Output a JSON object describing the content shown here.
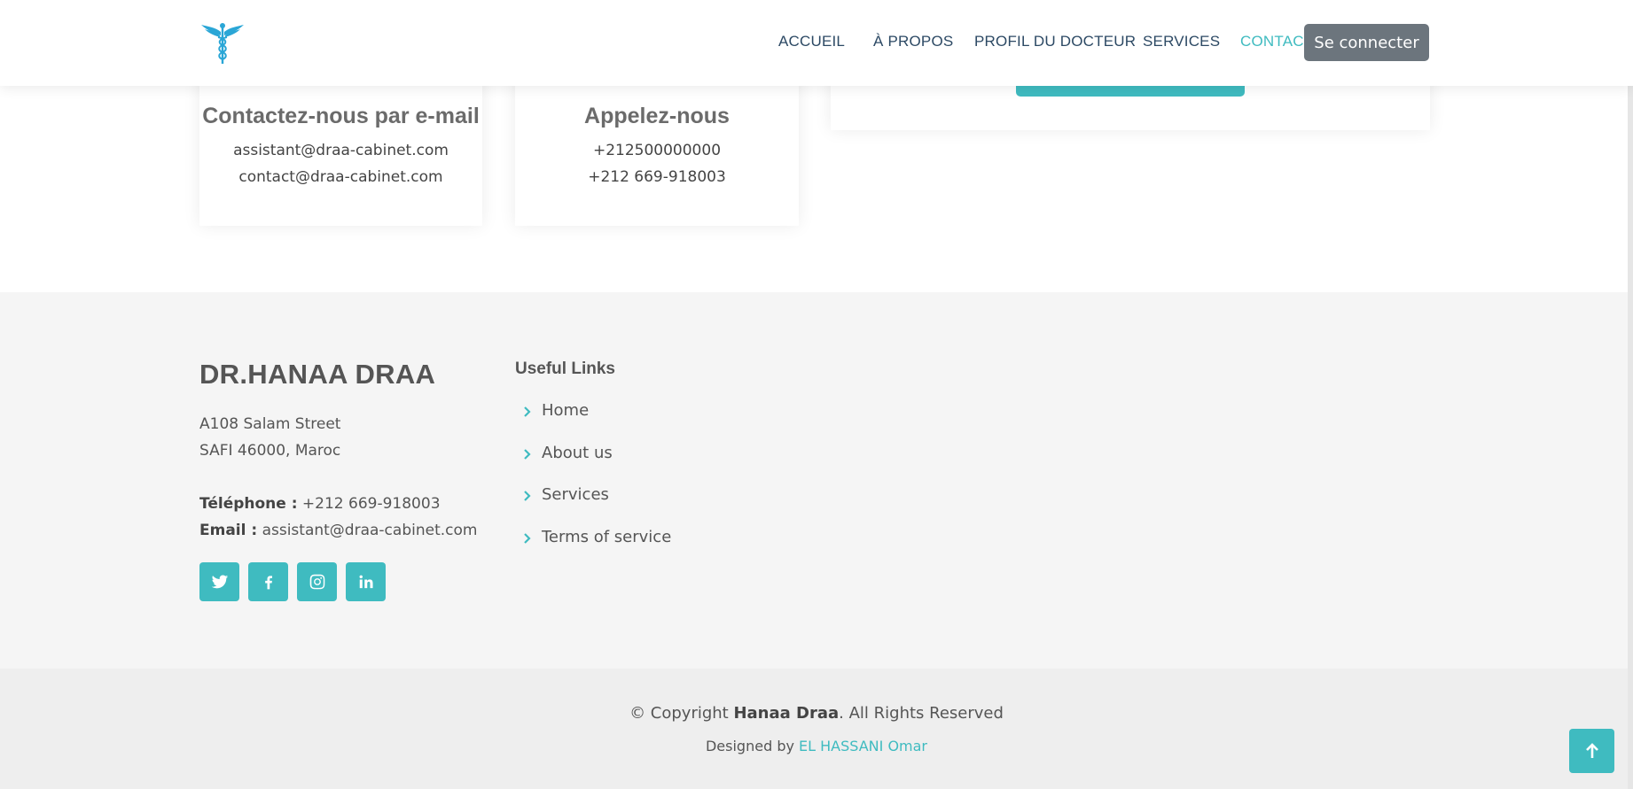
{
  "header": {
    "logo_icon": "caduceus-icon",
    "nav": [
      "ACCUEIL",
      "À PROPOS",
      "PROFIL DU DOCTEUR",
      "SERVICES",
      "CONTACT"
    ],
    "active": "CONTACT",
    "login_label": "Se connecter"
  },
  "contact": {
    "email_card": {
      "title": "Contactez-nous par e-mail",
      "lines": [
        "assistant@draa-cabinet.com",
        "contact@draa-cabinet.com"
      ]
    },
    "phone_card": {
      "title": "Appelez-nous",
      "lines": [
        "+212500000000",
        "+212 669-918003"
      ]
    }
  },
  "footer": {
    "brand": "DR.HANAA DRAA",
    "address_line1": "A108 Salam Street",
    "address_line2": "SAFI 46000, Maroc",
    "phone_label": "Téléphone :",
    "phone_value": " +212 669-918003",
    "email_label": "Email :",
    "email_value": " assistant@draa-cabinet.com",
    "social": [
      "twitter-icon",
      "facebook-icon",
      "instagram-icon",
      "linkedin-icon"
    ],
    "links_title": "Useful Links",
    "links": [
      "Home",
      "About us",
      "Services",
      "Terms of service"
    ],
    "copyright_prefix": "© Copyright ",
    "copyright_name": "Hanaa Draa",
    "copyright_suffix": ". All Rights Reserved",
    "designed_prefix": "Designed by ",
    "designed_author": "EL HASSANI Omar"
  },
  "colors": {
    "accent": "#3fbbc0",
    "nav_text": "#2c4964",
    "login_bg": "#6c757d",
    "footer_bg": "#f5f5f5",
    "footer_bottom_bg": "#eeeeee"
  }
}
